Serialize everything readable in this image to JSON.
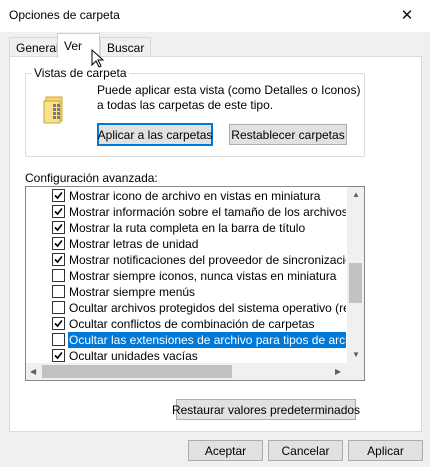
{
  "window": {
    "title": "Opciones de carpeta"
  },
  "tabs": [
    {
      "label": "General",
      "active": false
    },
    {
      "label": "Ver",
      "active": true
    },
    {
      "label": "Buscar",
      "active": false
    }
  ],
  "folder_views": {
    "group_label": "Vistas de carpeta",
    "description": "Puede aplicar esta vista (como Detalles o Iconos) a todas las carpetas de este tipo.",
    "apply_button": "Aplicar a las carpetas",
    "reset_button": "Restablecer carpetas",
    "icon": "folder-icon"
  },
  "advanced": {
    "label": "Configuración avanzada:",
    "items": [
      {
        "label": "Mostrar icono de archivo en vistas en miniatura",
        "checked": true,
        "selected": false
      },
      {
        "label": "Mostrar información sobre el tamaño de los archivos en su",
        "checked": true,
        "selected": false
      },
      {
        "label": "Mostrar la ruta completa en la barra de título",
        "checked": true,
        "selected": false
      },
      {
        "label": "Mostrar letras de unidad",
        "checked": true,
        "selected": false
      },
      {
        "label": "Mostrar notificaciones del proveedor de sincronización",
        "checked": true,
        "selected": false
      },
      {
        "label": "Mostrar siempre iconos, nunca vistas en miniatura",
        "checked": false,
        "selected": false
      },
      {
        "label": "Mostrar siempre menús",
        "checked": false,
        "selected": false
      },
      {
        "label": "Ocultar archivos protegidos del sistema operativo (recome",
        "checked": false,
        "selected": false
      },
      {
        "label": "Ocultar conflictos de combinación de carpetas",
        "checked": true,
        "selected": false
      },
      {
        "label": "Ocultar las extensiones de archivo para tipos de archivo c",
        "checked": false,
        "selected": true
      },
      {
        "label": "Ocultar unidades vacías",
        "checked": true,
        "selected": false
      }
    ]
  },
  "restore_defaults_button": "Restaurar valores predeterminados",
  "footer": {
    "accept": "Aceptar",
    "cancel": "Cancelar",
    "apply": "Aplicar"
  },
  "colors": {
    "accent": "#0078d7",
    "selection": "#0078d7",
    "background": "#f0f0f0"
  }
}
